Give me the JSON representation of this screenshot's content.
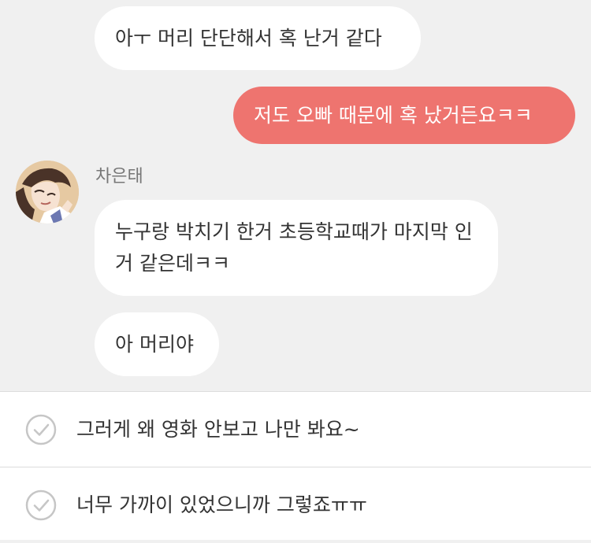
{
  "chat": {
    "messages": [
      {
        "direction": "incoming",
        "text": "아ㅜ 머리 단단해서 혹 난거 같다"
      },
      {
        "direction": "outgoing",
        "text": "저도 오빠 때문에 혹 났거든요ㅋㅋ"
      },
      {
        "direction": "incoming",
        "sender": "차은태",
        "text": "누구랑 박치기 한거 초등학교때가 마지막 인거 같은데ㅋㅋ"
      },
      {
        "direction": "incoming",
        "text": "아 머리야"
      }
    ]
  },
  "choices": [
    {
      "text": "그러게 왜 영화 안보고 나만 봐요~",
      "icon": "check-circle-icon"
    },
    {
      "text": "너무 가까이 있었으니까 그렇죠ㅠㅠ",
      "icon": "check-circle-icon"
    }
  ],
  "colors": {
    "outgoing_bubble": "#ee746f",
    "incoming_bubble": "#ffffff",
    "chat_background": "#f0f0f0"
  }
}
